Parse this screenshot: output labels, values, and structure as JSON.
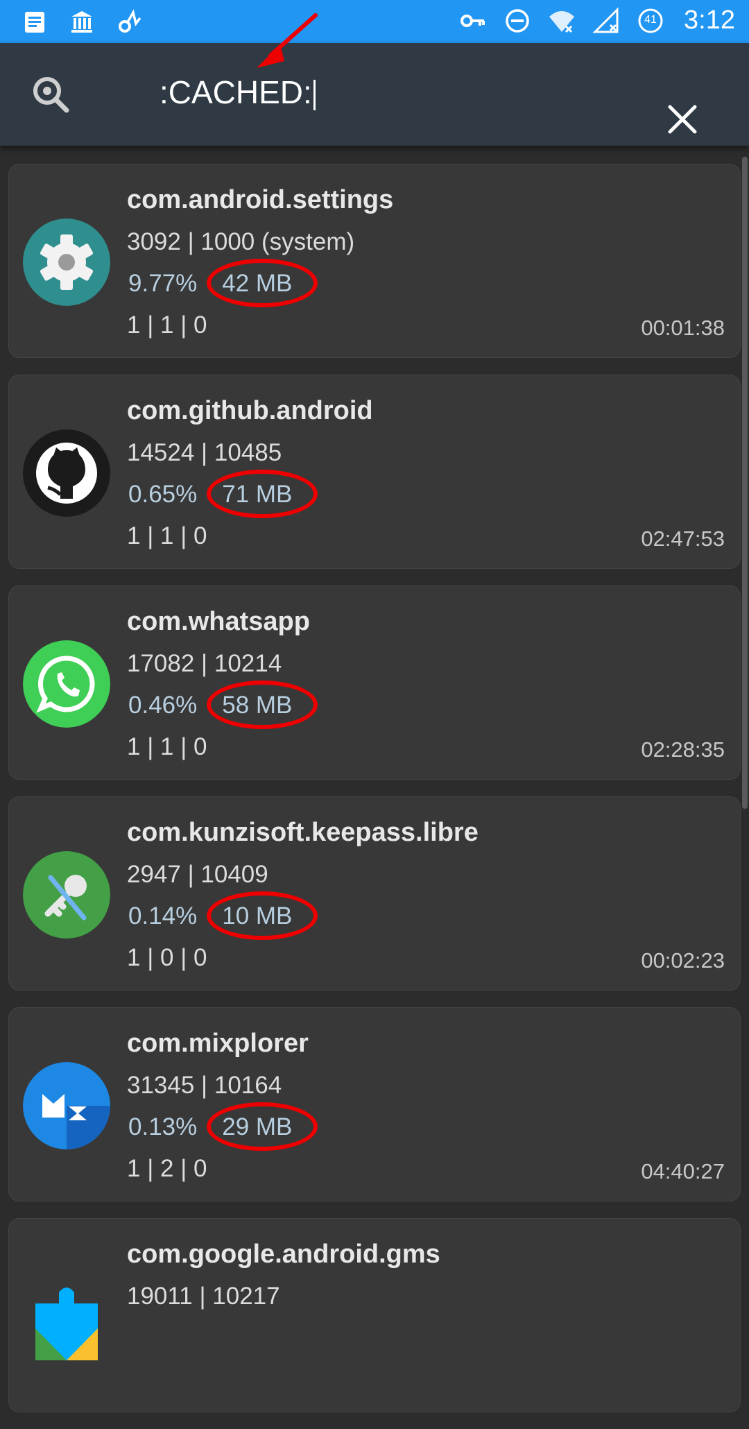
{
  "status_bar": {
    "time": "3:12",
    "battery_level": "41",
    "left_icons": [
      "document-icon",
      "bank-icon",
      "sync-settings-icon"
    ],
    "right_icons": [
      "vpn-key-icon",
      "do-not-disturb-icon",
      "wifi-icon",
      "signal-icon",
      "battery-icon"
    ],
    "color": "#2196f3"
  },
  "search": {
    "value": ":CACHED:"
  },
  "processes": [
    {
      "package": "com.android.settings",
      "ids": "3092 | 1000 (system)",
      "cpu": "9.77%",
      "memory": "42 MB",
      "counts": "1 | 1 | 0",
      "time": "00:01:38",
      "icon": "settings-gear-icon"
    },
    {
      "package": "com.github.android",
      "ids": "14524 | 10485",
      "cpu": "0.65%",
      "memory": "71 MB",
      "counts": "1 | 1 | 0",
      "time": "02:47:53",
      "icon": "github-icon"
    },
    {
      "package": "com.whatsapp",
      "ids": "17082 | 10214",
      "cpu": "0.46%",
      "memory": "58 MB",
      "counts": "1 | 1 | 0",
      "time": "02:28:35",
      "icon": "whatsapp-icon"
    },
    {
      "package": "com.kunzisoft.keepass.libre",
      "ids": "2947 | 10409",
      "cpu": "0.14%",
      "memory": "10 MB",
      "counts": "1 | 0 | 0",
      "time": "00:02:23",
      "icon": "keepass-key-icon"
    },
    {
      "package": "com.mixplorer",
      "ids": "31345 | 10164",
      "cpu": "0.13%",
      "memory": "29 MB",
      "counts": "1 | 2 | 0",
      "time": "04:40:27",
      "icon": "mixplorer-icon"
    },
    {
      "package": "com.google.android.gms",
      "ids": "19011 | 10217",
      "cpu": "",
      "memory": "",
      "counts": "",
      "time": "",
      "icon": "play-services-icon"
    }
  ],
  "colors": {
    "annotation_red": "#e00000",
    "card": "#383838",
    "toolbar": "#2f3a44"
  }
}
